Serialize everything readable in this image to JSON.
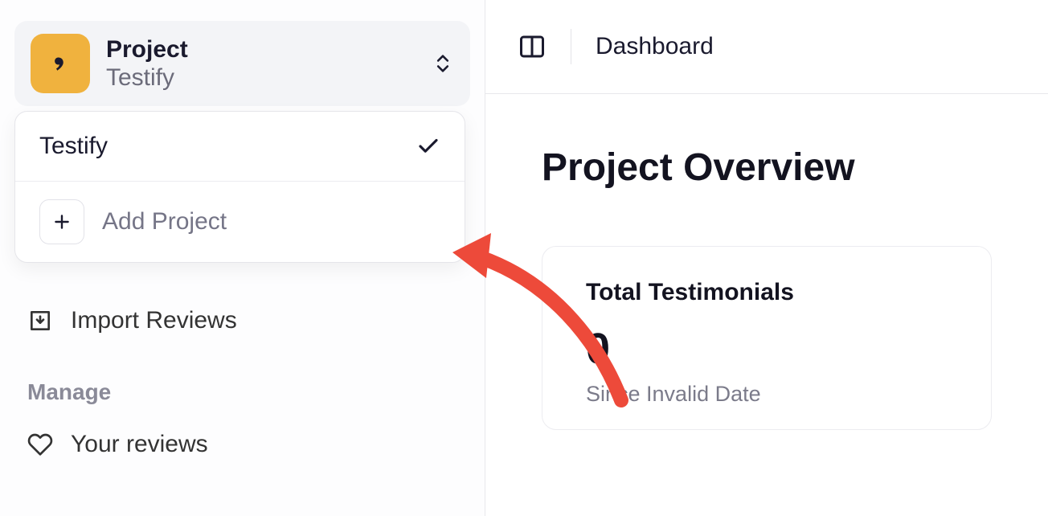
{
  "project_selector": {
    "label": "Project",
    "name": "Testify"
  },
  "dropdown": {
    "items": [
      {
        "label": "Testify",
        "selected": true
      }
    ],
    "add_label": "Add Project"
  },
  "sidebar": {
    "import_reviews": "Import Reviews",
    "manage_header": "Manage",
    "your_reviews": "Your reviews"
  },
  "topbar": {
    "title": "Dashboard"
  },
  "main": {
    "page_title": "Project Overview",
    "card": {
      "label": "Total Testimonials",
      "value": "0",
      "subtext": "Since Invalid Date"
    }
  }
}
